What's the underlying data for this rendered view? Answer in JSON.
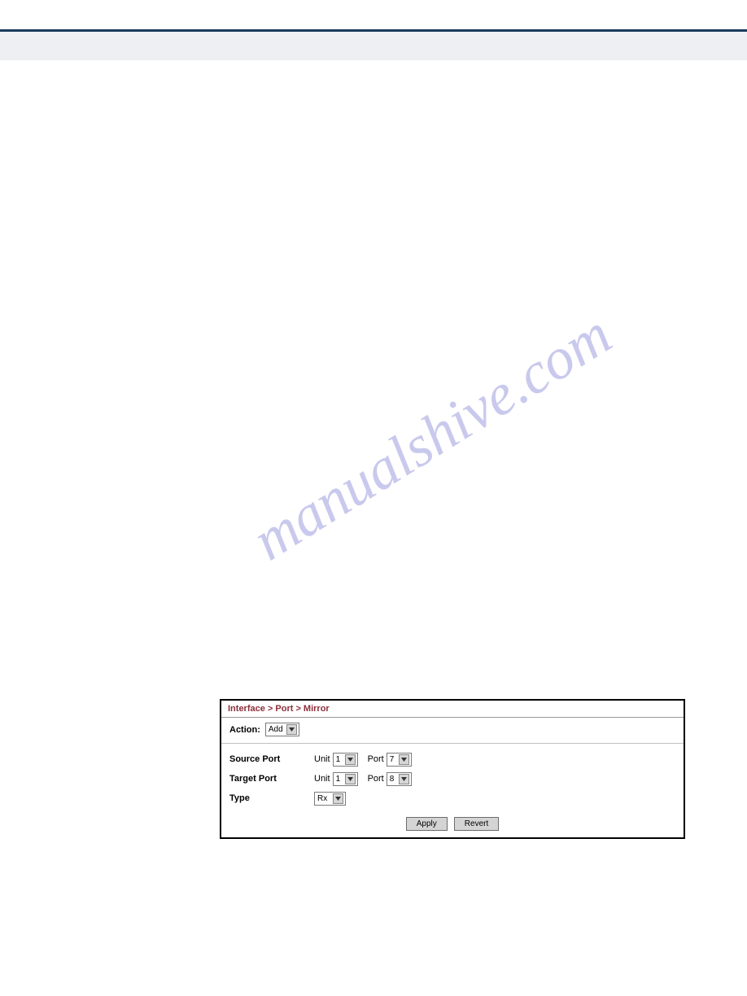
{
  "watermark": "manualshive.com",
  "panel": {
    "breadcrumb": "Interface > Port > Mirror",
    "action": {
      "label": "Action:",
      "value": "Add"
    },
    "source_port": {
      "label": "Source Port",
      "unit_label": "Unit",
      "unit_value": "1",
      "port_label": "Port",
      "port_value": "7"
    },
    "target_port": {
      "label": "Target Port",
      "unit_label": "Unit",
      "unit_value": "1",
      "port_label": "Port",
      "port_value": "8"
    },
    "type": {
      "label": "Type",
      "value": "Rx"
    },
    "buttons": {
      "apply": "Apply",
      "revert": "Revert"
    }
  }
}
